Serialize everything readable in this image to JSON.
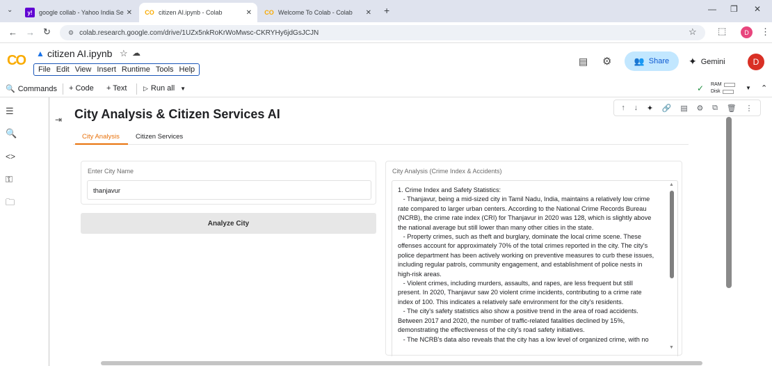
{
  "browser": {
    "tabs": [
      {
        "title": "google collab - Yahoo India Se",
        "icon": "yahoo-icon"
      },
      {
        "title": "citizen AI.ipynb - Colab",
        "icon": "colab-icon",
        "active": true
      },
      {
        "title": "Welcome To Colab - Colab",
        "icon": "colab-icon"
      }
    ],
    "url": "colab.research.google.com/drive/1UZx5nkRoKrWoMwsc-CKRYHy6jdGsJCJN",
    "profile_initial": "D"
  },
  "colab": {
    "notebook_title": "citizen AI.ipynb",
    "menu": [
      "File",
      "Edit",
      "View",
      "Insert",
      "Runtime",
      "Tools",
      "Help"
    ],
    "share_label": "Share",
    "gemini_label": "Gemini",
    "avatar_initial": "D",
    "toolbar": {
      "commands": "Commands",
      "code": "+ Code",
      "text": "+ Text",
      "run_all": "Run all"
    },
    "ram_label": "RAM",
    "disk_label": "Disk"
  },
  "app": {
    "title": "City Analysis & Citizen Services AI",
    "tabs": [
      "City Analysis",
      "Citizen Services"
    ],
    "input_label": "Enter City Name",
    "input_value": "thanjavur",
    "button_label": "Analyze City",
    "output_label": "City Analysis (Crime Index & Accidents)",
    "output_lines": [
      "1. Crime Index and Safety Statistics:",
      "   - Thanjavur, being a mid-sized city in Tamil Nadu, India, maintains a relatively low crime",
      "rate compared to larger urban centers. According to the National Crime Records Bureau",
      "(NCRB), the crime rate index (CRI) for Thanjavur in 2020 was 128, which is slightly above",
      "the national average but still lower than many other cities in the state.",
      "   - Property crimes, such as theft and burglary, dominate the local crime scene. These",
      "offenses account for approximately 70% of the total crimes reported in the city. The city's",
      "police department has been actively working on preventive measures to curb these issues,",
      "including regular patrols, community engagement, and establishment of police nests in",
      "high-risk areas.",
      "   - Violent crimes, including murders, assaults, and rapes, are less frequent but still",
      "present. In 2020, Thanjavur saw 20 violent crime incidents, contributing to a crime rate",
      "index of 100. This indicates a relatively safe environment for the city's residents.",
      "   - The city's safety statistics also show a positive trend in the area of road accidents.",
      "Between 2017 and 2020, the number of traffic-related fatalities declined by 15%,",
      "demonstrating the effectiveness of the city's road safety initiatives.",
      "   - The NCRB's data also reveals that the city has a low level of organized crime, with no"
    ]
  },
  "colors": {
    "accent_orange": "#e8710a",
    "share_bg": "#c2e7ff",
    "avatar_bg": "#d93025",
    "menu_border": "#1a56b8"
  }
}
